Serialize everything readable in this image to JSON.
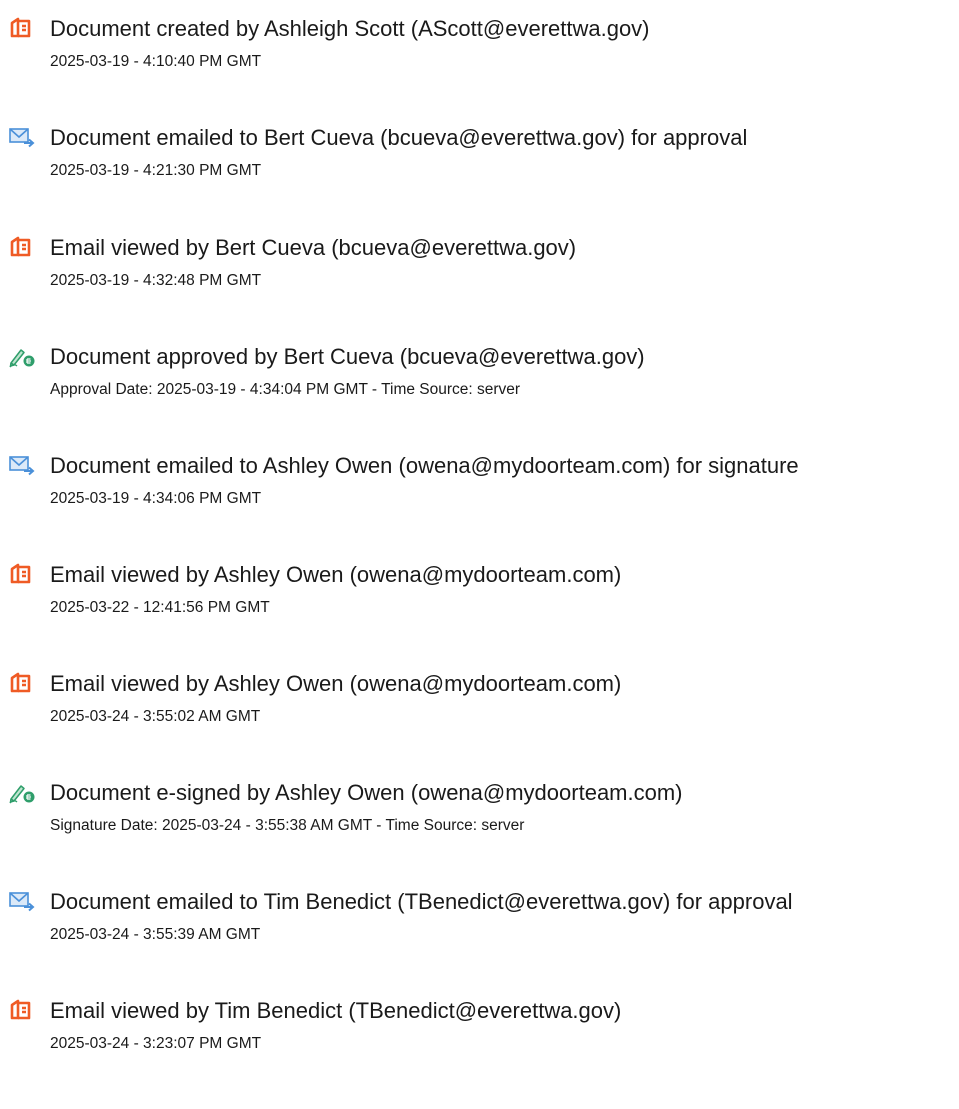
{
  "events": [
    {
      "icon": "document-created-icon",
      "title": "Document created by Ashleigh Scott (AScott@everettwa.gov)",
      "detail": "2025-03-19 - 4:10:40 PM GMT"
    },
    {
      "icon": "email-sent-icon",
      "title": "Document emailed to Bert Cueva (bcueva@everettwa.gov) for approval",
      "detail": "2025-03-19 - 4:21:30 PM GMT"
    },
    {
      "icon": "document-viewed-icon",
      "title": "Email viewed by Bert Cueva (bcueva@everettwa.gov)",
      "detail": "2025-03-19 - 4:32:48 PM GMT"
    },
    {
      "icon": "esign-pen-icon",
      "title": "Document approved by Bert Cueva (bcueva@everettwa.gov)",
      "detail": "Approval Date: 2025-03-19 - 4:34:04 PM GMT - Time Source: server"
    },
    {
      "icon": "email-sent-icon",
      "title": "Document emailed to Ashley Owen (owena@mydoorteam.com) for signature",
      "detail": "2025-03-19 - 4:34:06 PM GMT"
    },
    {
      "icon": "document-viewed-icon",
      "title": "Email viewed by Ashley Owen (owena@mydoorteam.com)",
      "detail": "2025-03-22 - 12:41:56 PM GMT"
    },
    {
      "icon": "document-viewed-icon",
      "title": "Email viewed by Ashley Owen (owena@mydoorteam.com)",
      "detail": "2025-03-24 - 3:55:02 AM GMT"
    },
    {
      "icon": "esign-pen-icon",
      "title": "Document e-signed by Ashley Owen (owena@mydoorteam.com)",
      "detail": "Signature Date: 2025-03-24 - 3:55:38 AM GMT - Time Source: server"
    },
    {
      "icon": "email-sent-icon",
      "title": "Document emailed to Tim Benedict (TBenedict@everettwa.gov) for approval",
      "detail": "2025-03-24 - 3:55:39 AM GMT"
    },
    {
      "icon": "document-viewed-icon",
      "title": "Email viewed by Tim Benedict (TBenedict@everettwa.gov)",
      "detail": "2025-03-24 - 3:23:07 PM GMT"
    }
  ],
  "colors": {
    "document_icon": "#ef5b25",
    "email_icon": "#4a90d9",
    "esign_icon": "#2f9e6b",
    "text": "#1a1a1a"
  }
}
